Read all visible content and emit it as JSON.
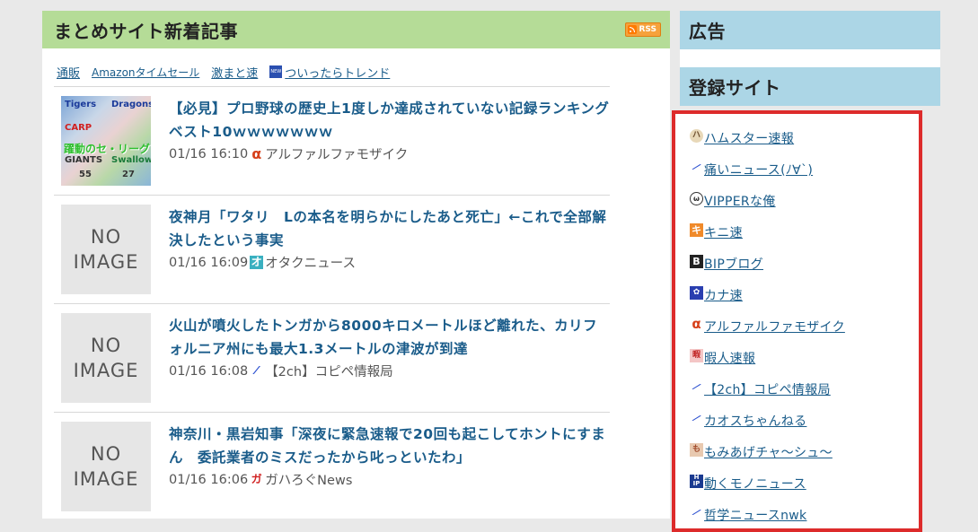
{
  "main": {
    "title": "まとめサイト新着記事",
    "rss_label": "RSS",
    "tabs": [
      "通販",
      "Amazonタイムセール",
      "激まと速",
      "ついったらトレンド"
    ],
    "articles": [
      {
        "title": "【必見】プロ野球の歴史上1度しか達成されていない記録ランキングベスト10ｗｗｗｗｗｗｗ",
        "date": "01/16 16:10",
        "source": "アルファルファモザイク",
        "thumb": "image",
        "thumb_text": [
          "Tigers",
          "CARP",
          "Dragons",
          "Swallows",
          "GIANTS",
          "躍動のセ・リーグ",
          "55",
          "27"
        ]
      },
      {
        "title": "夜神月「ワタリ　Lの本名を明らかにしたあと死亡」←これで全部解決したという事実",
        "date": "01/16 16:09",
        "source": "オタクニュース",
        "thumb": "noimage"
      },
      {
        "title": "火山が噴火したトンガから8000キロメートルほど離れた、カリフォルニア州にも最大1.3メートルの津波が到達",
        "date": "01/16 16:08",
        "source": "【2ch】コピペ情報局",
        "thumb": "noimage"
      },
      {
        "title": "神奈川・黒岩知事「深夜に緊急速報で20回も起こしてホントにすまん　委託業者のミスだったから叱っといたわ」",
        "date": "01/16 16:06",
        "source": "ガハろぐNews",
        "thumb": "noimage"
      }
    ],
    "noimage_text": [
      "NO",
      "IMAGE"
    ]
  },
  "sidebar": {
    "ad_title": "広告",
    "sites_title": "登録サイト",
    "sites": [
      "ハムスター速報",
      "痛いニュース(ﾉ∀`)",
      "VIPPERな俺",
      "キニ速",
      "BIPブログ",
      "カナ速",
      "アルファルファモザイク",
      "暇人速報",
      "【2ch】コピペ情報局",
      "カオスちゃんねる",
      "もみあげチャ～シュ～",
      "動くモノニュース",
      "哲学ニュースnwk"
    ]
  },
  "colors": {
    "main_header": "#b5dc97",
    "side_header": "#acd6e6",
    "link": "#1a5c8a",
    "highlight_border": "#dd2b2b"
  }
}
